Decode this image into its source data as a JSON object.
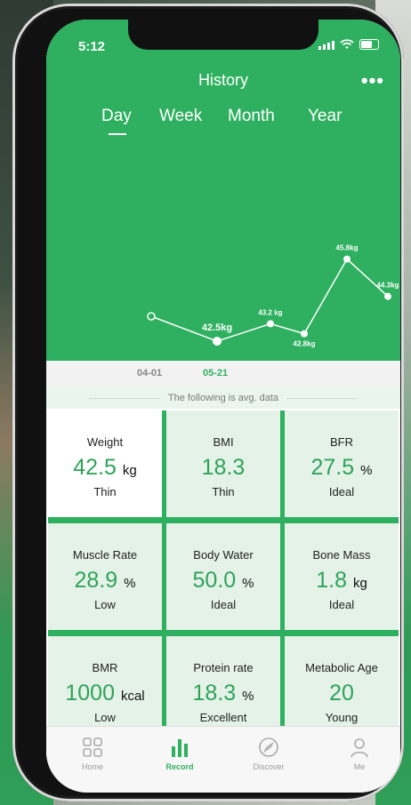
{
  "status": {
    "time": "5:12"
  },
  "header": {
    "title": "History",
    "more": "•••"
  },
  "tabs": [
    {
      "label": "Day"
    },
    {
      "label": "Week"
    },
    {
      "label": "Month"
    },
    {
      "label": "Year"
    }
  ],
  "chart_data": {
    "type": "line",
    "x": [
      "04-01",
      "",
      "05-21",
      "",
      "",
      "",
      ""
    ],
    "points": [
      {
        "value": null,
        "label": ""
      },
      {
        "value": 42.5,
        "label": "42.5kg"
      },
      {
        "value": 43.2,
        "label": "43.2 kg"
      },
      {
        "value": 42.8,
        "label": "42.8kg"
      },
      {
        "value": 45.8,
        "label": "45.8kg"
      },
      {
        "value": 44.3,
        "label": "44.3kg"
      }
    ]
  },
  "dates": [
    "04-01",
    "05-21"
  ],
  "avg_note": "The following is avg. data",
  "metrics": [
    {
      "label": "Weight",
      "value": "42.5",
      "unit": "kg",
      "status": "Thin"
    },
    {
      "label": "BMI",
      "value": "18.3",
      "unit": "",
      "status": "Thin"
    },
    {
      "label": "BFR",
      "value": "27.5",
      "unit": "%",
      "status": "Ideal"
    },
    {
      "label": "Muscle Rate",
      "value": "28.9",
      "unit": "%",
      "status": "Low"
    },
    {
      "label": "Body Water",
      "value": "50.0",
      "unit": "%",
      "status": "Ideal"
    },
    {
      "label": "Bone Mass",
      "value": "1.8",
      "unit": "kg",
      "status": "Ideal"
    },
    {
      "label": "BMR",
      "value": "1000",
      "unit": "kcal",
      "status": "Low"
    },
    {
      "label": "Protein rate",
      "value": "18.3",
      "unit": "%",
      "status": "Excellent"
    },
    {
      "label": "Metabolic Age",
      "value": "20",
      "unit": "",
      "status": "Young"
    }
  ],
  "tabbar": [
    {
      "label": "Home",
      "icon": "grid-icon"
    },
    {
      "label": "Record",
      "icon": "bar-chart-icon"
    },
    {
      "label": "Discover",
      "icon": "compass-icon"
    },
    {
      "label": "Me",
      "icon": "person-icon"
    }
  ],
  "colors": {
    "accent": "#2fb060",
    "cell": "#e4f2e8"
  }
}
